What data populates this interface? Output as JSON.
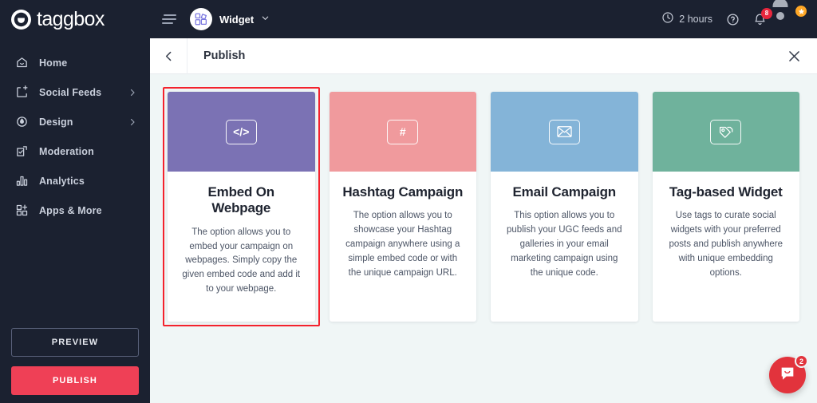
{
  "brand": {
    "name": "taggbox",
    "logo_icon": "taggbox-logo-icon"
  },
  "sidebar": {
    "items": [
      {
        "label": "Home",
        "icon": "home-icon",
        "has_chevron": false
      },
      {
        "label": "Social Feeds",
        "icon": "feed-add-icon",
        "has_chevron": true
      },
      {
        "label": "Design",
        "icon": "design-droplet-icon",
        "has_chevron": true
      },
      {
        "label": "Moderation",
        "icon": "moderation-check-icon",
        "has_chevron": false
      },
      {
        "label": "Analytics",
        "icon": "analytics-bars-icon",
        "has_chevron": false
      },
      {
        "label": "Apps & More",
        "icon": "apps-grid-icon",
        "has_chevron": false
      }
    ],
    "preview_label": "PREVIEW",
    "publish_label": "PUBLISH",
    "publish_color": "#ef4056"
  },
  "topbar": {
    "menu_icon": "hamburger-icon",
    "widget_icon": "widget-grid-icon",
    "widget_name": "Widget",
    "widget_chevron_icon": "chevron-down-icon",
    "clock_icon": "clock-icon",
    "hours_text": "2 hours",
    "help_icon": "help-circle-icon",
    "bell_icon": "bell-icon",
    "bell_badge": "8",
    "bell_badge_color": "#e8263c",
    "avatar_icon": "avatar",
    "avatar_badge_icon": "star-icon",
    "avatar_badge_color": "#ffa726"
  },
  "page_header": {
    "back_icon": "chevron-left-icon",
    "title": "Publish",
    "close_icon": "close-icon"
  },
  "cards": [
    {
      "title": "Embed On Webpage",
      "description": "The option allows you to embed your campaign on webpages. Simply copy the given embed code and add it to your webpage.",
      "icon": "code-brackets-icon",
      "glyph": "</>",
      "banner_color": "#7b72b4",
      "selected": true
    },
    {
      "title": "Hashtag Campaign",
      "description": "The option allows you to showcase your Hashtag campaign anywhere using a simple embed code or with the unique campaign URL.",
      "icon": "hashtag-icon",
      "glyph": "#",
      "banner_color": "#f09a9d",
      "selected": false
    },
    {
      "title": "Email Campaign",
      "description": "This option allows you to publish your UGC feeds and galleries in your email marketing campaign using the unique code.",
      "icon": "envelope-icon",
      "glyph": "",
      "banner_color": "#84b4d8",
      "selected": false
    },
    {
      "title": "Tag-based Widget",
      "description": "Use tags to curate social widgets with your preferred posts and publish anywhere with unique embedding options.",
      "icon": "tag-icon",
      "glyph": "",
      "banner_color": "#6fb29c",
      "selected": false
    }
  ],
  "chat": {
    "icon": "chat-bubble-icon",
    "badge": "2",
    "color": "#e2333c"
  },
  "selection_highlight_color": "#f4222d"
}
